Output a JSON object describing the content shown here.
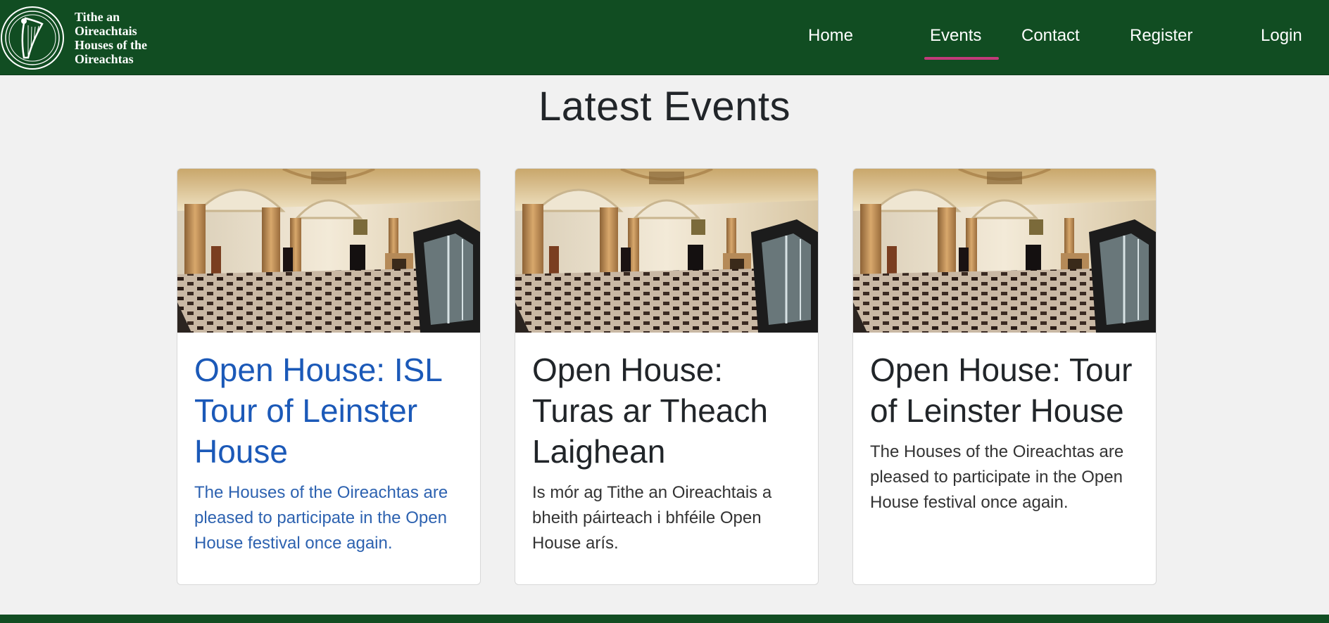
{
  "brand": {
    "emblem": "harp-emblem",
    "line1": "Tithe an",
    "line2": "Oireachtais",
    "line3": "Houses of the",
    "line4": "Oireachtas"
  },
  "nav": {
    "home": "Home",
    "events": "Events",
    "contact": "Contact",
    "register": "Register",
    "login": "Login",
    "active": "Events",
    "active_color": "#c23b7a"
  },
  "page": {
    "title": "Latest Events"
  },
  "events": [
    {
      "title": "Open House: ISL Tour of Leinster House",
      "description": "The Houses of the Oireachtas are pleased to participate in the Open House festival once again.",
      "image": "leinster-house-entrance-hall-photo",
      "hovered": true
    },
    {
      "title": "Open House: Turas ar Theach Laighean",
      "description": "Is mór ag Tithe an Oireachtais a bheith páirteach i bhféile Open House arís.",
      "image": "leinster-house-entrance-hall-photo"
    },
    {
      "title": "Open House: Tour of Leinster House",
      "description": "The Houses of the Oireachtas are pleased to participate in the Open House festival once again.",
      "image": "leinster-house-entrance-hall-photo"
    }
  ],
  "colors": {
    "header_bg": "#114d22",
    "page_bg": "#f1f1f1",
    "link_hover": "#1b59b8"
  }
}
